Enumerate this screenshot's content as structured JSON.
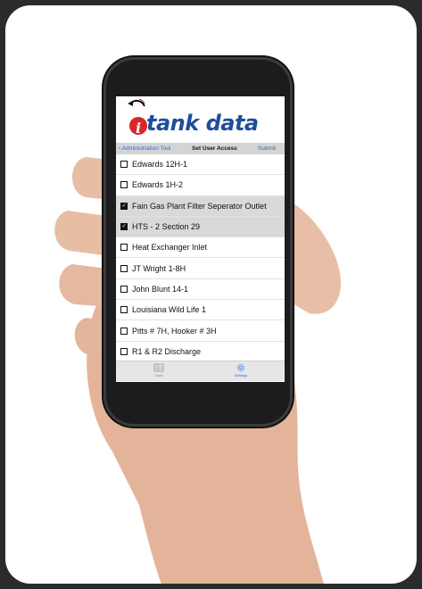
{
  "app": {
    "logo_text": "tank data",
    "logo_letter": "i"
  },
  "navbar": {
    "back_label": "Administration Tool",
    "title": "Set User Access",
    "submit_label": "Submit"
  },
  "items": [
    {
      "label": "Edwards 12H-1",
      "checked": false
    },
    {
      "label": "Edwards 1H-2",
      "checked": false
    },
    {
      "label": "Fain Gas Plant Filter Seperator Outlet",
      "checked": true
    },
    {
      "label": "HTS - 2 Section 29",
      "checked": true
    },
    {
      "label": "Heat Exchanger Inlet",
      "checked": false
    },
    {
      "label": "JT Wright 1-8H",
      "checked": false
    },
    {
      "label": "John Blunt 14-1",
      "checked": false
    },
    {
      "label": "Louisiana Wild Life 1",
      "checked": false
    },
    {
      "label": "Pitts # 7H, Hooker # 3H",
      "checked": false
    },
    {
      "label": "R1 & R2 Discharge",
      "checked": false
    }
  ],
  "tabbar": {
    "tabs": [
      {
        "label": "Data",
        "icon": "table-icon",
        "active": false
      },
      {
        "label": "Settings",
        "icon": "gear-icon",
        "active": true
      }
    ]
  },
  "colors": {
    "brand_blue": "#1f4e9a",
    "brand_red": "#d9262b",
    "link_blue": "#2a6bd6"
  }
}
